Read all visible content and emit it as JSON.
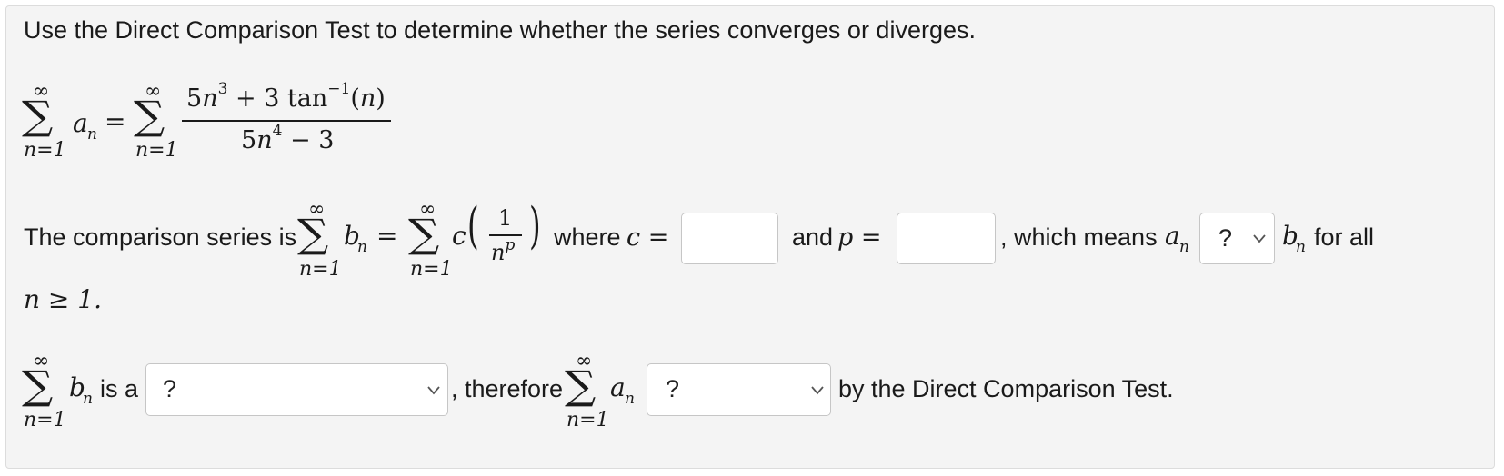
{
  "instructions": "Use the Direct Comparison Test to determine whether the series converges or diverges.",
  "series": {
    "sum_upper": "∞",
    "sum_lower": "n=1",
    "term_a": "a",
    "sub_n": "n",
    "equals": "=",
    "numerator_part1": "5",
    "numerator_n": "n",
    "numerator_exp": "3",
    "numerator_part2": " + 3 tan",
    "numerator_inv": "−1",
    "numerator_part3": "(",
    "numerator_arg": "n",
    "numerator_part4": ")",
    "denominator_part1": "5",
    "denominator_n": "n",
    "denominator_exp": "4",
    "denominator_part2": " − 3"
  },
  "comparison": {
    "prefix": "The comparison series is",
    "term_b": "b",
    "c_symbol": "c",
    "frac_num": "1",
    "frac_den_n": "n",
    "frac_den_p": "p",
    "where_label": "where",
    "c_equals": "c =",
    "c_input_value": "",
    "and_label": "and",
    "p_equals": "p =",
    "p_input_value": "",
    "which_means": ", which means",
    "relation_select_value": "?",
    "for_all": "for all",
    "condition": "n ≥ 1."
  },
  "conclusion": {
    "is_a": "is a",
    "series_type_select_value": "?",
    "therefore": ", therefore",
    "behavior_select_value": "?",
    "by_test": "by the Direct Comparison Test."
  }
}
